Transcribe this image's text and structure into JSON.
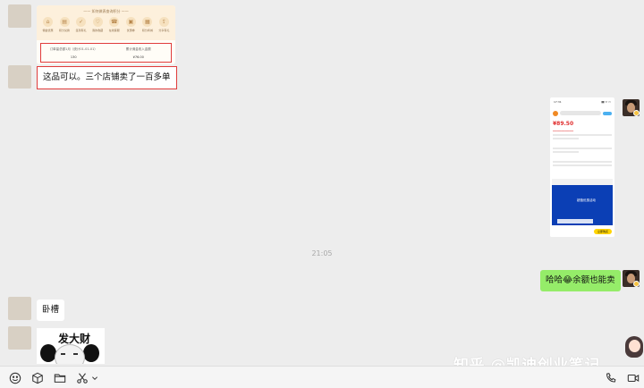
{
  "messages": {
    "card1": {
      "banner_title": "—— 如何做表查询积分 ——",
      "icons": [
        {
          "label": "佣金优惠",
          "glyph": "⌂"
        },
        {
          "label": "积分兑换",
          "glyph": "▤"
        },
        {
          "label": "签到有礼",
          "glyph": "✓"
        },
        {
          "label": "我的收藏",
          "glyph": "♡"
        },
        {
          "label": "在线客服",
          "glyph": "☎"
        },
        {
          "label": "优惠券",
          "glyph": "▣"
        },
        {
          "label": "积分商城",
          "glyph": "▦"
        },
        {
          "label": "分享有礼",
          "glyph": "⇪"
        }
      ],
      "stat_left_key": "订单量总额1月（统计01-01-01）",
      "stat_left_value": "130",
      "stat_right_key": "累计佣金收入金额",
      "stat_right_value": "¥76.00"
    },
    "text1": "这品可以。三个店铺卖了一百多单",
    "phone": {
      "status_time": "17:31",
      "status_right": "▮▮ ᯤ ▭",
      "price": "¥89.50",
      "sub": "▁▁▁▁▁▁▁▁▁▁",
      "banner_text": "超值优惠活动",
      "cta": "立即购买"
    },
    "timestamp": "21:05",
    "text_green": "哈哈😂余额也能卖",
    "text2": "卧槽",
    "meme_text": "发大财"
  },
  "watermark": "知乎 @凯迪创业笔记",
  "toolbar": {
    "left": [
      "emoji-icon",
      "package-icon",
      "folder-icon",
      "scissors-icon",
      "chevron-down-icon"
    ],
    "right": [
      "phone-icon",
      "video-icon"
    ]
  },
  "colors": {
    "background": "#ededed",
    "bubble_green": "#95ec69",
    "highlight_red": "#e03c3c"
  }
}
